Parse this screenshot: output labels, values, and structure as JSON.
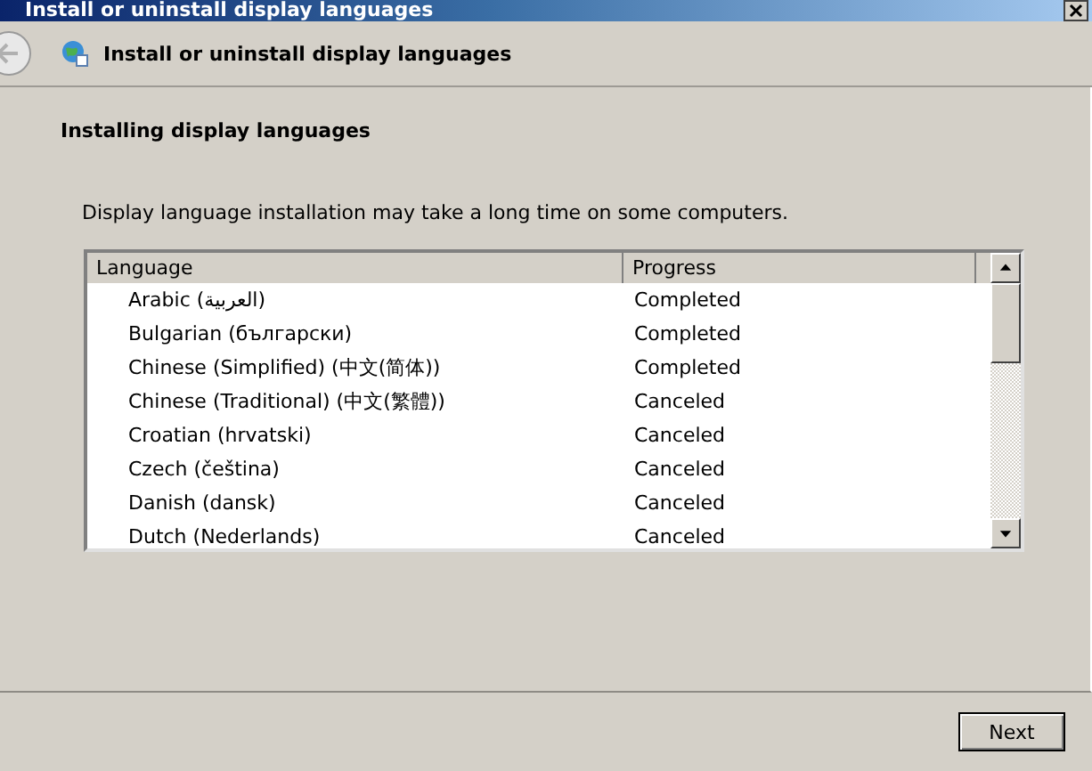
{
  "window": {
    "title": "Install or uninstall display languages"
  },
  "nav": {
    "title": "Install or uninstall display languages"
  },
  "heading": "Installing display languages",
  "description": "Display language installation may take a long time on some computers.",
  "table": {
    "columns": [
      "Language",
      "Progress"
    ],
    "rows": [
      {
        "language": "Arabic (العربية)",
        "progress": "Completed"
      },
      {
        "language": "Bulgarian (български)",
        "progress": "Completed"
      },
      {
        "language": "Chinese (Simplified) (中文(简体))",
        "progress": "Completed"
      },
      {
        "language": "Chinese (Traditional) (中文(繁體))",
        "progress": "Canceled"
      },
      {
        "language": "Croatian (hrvatski)",
        "progress": "Canceled"
      },
      {
        "language": "Czech (čeština)",
        "progress": "Canceled"
      },
      {
        "language": "Danish (dansk)",
        "progress": "Canceled"
      },
      {
        "language": "Dutch (Nederlands)",
        "progress": "Canceled"
      }
    ]
  },
  "buttons": [
    {
      "label": "Next"
    }
  ]
}
